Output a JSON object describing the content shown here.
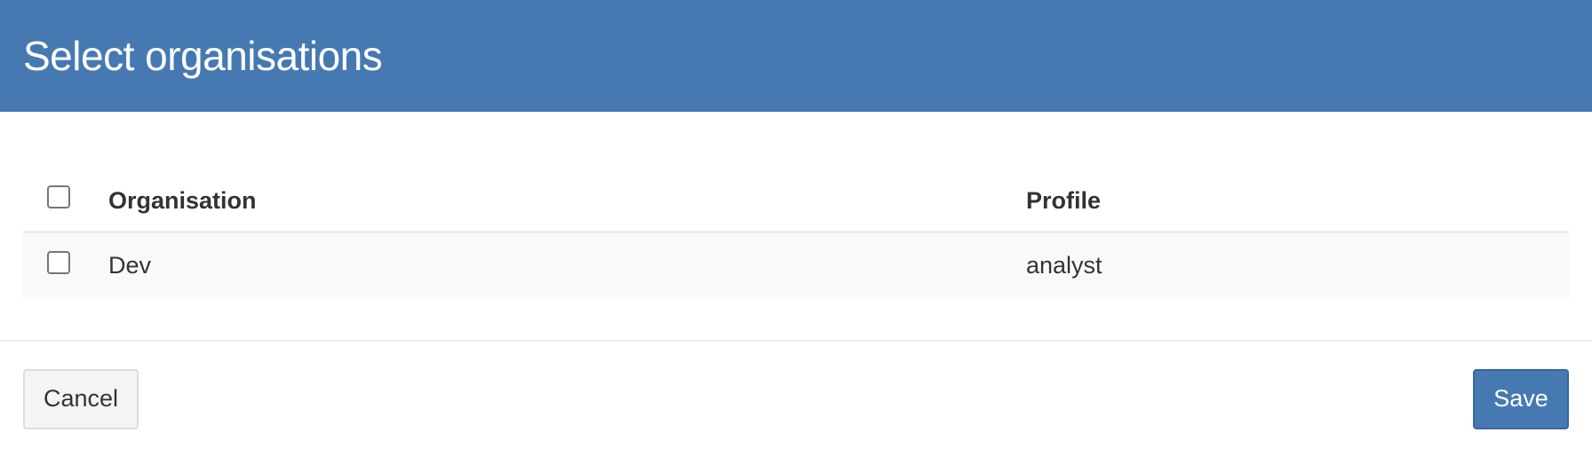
{
  "modal": {
    "title": "Select organisations"
  },
  "table": {
    "headers": {
      "organisation": "Organisation",
      "profile": "Profile"
    },
    "rows": [
      {
        "organisation": "Dev",
        "profile": "analyst",
        "checked": false
      }
    ]
  },
  "footer": {
    "cancel_label": "Cancel",
    "save_label": "Save"
  },
  "colors": {
    "header_bg": "#4679b2",
    "primary_button": "#4679b2",
    "row_bg": "#f9f9f9"
  }
}
